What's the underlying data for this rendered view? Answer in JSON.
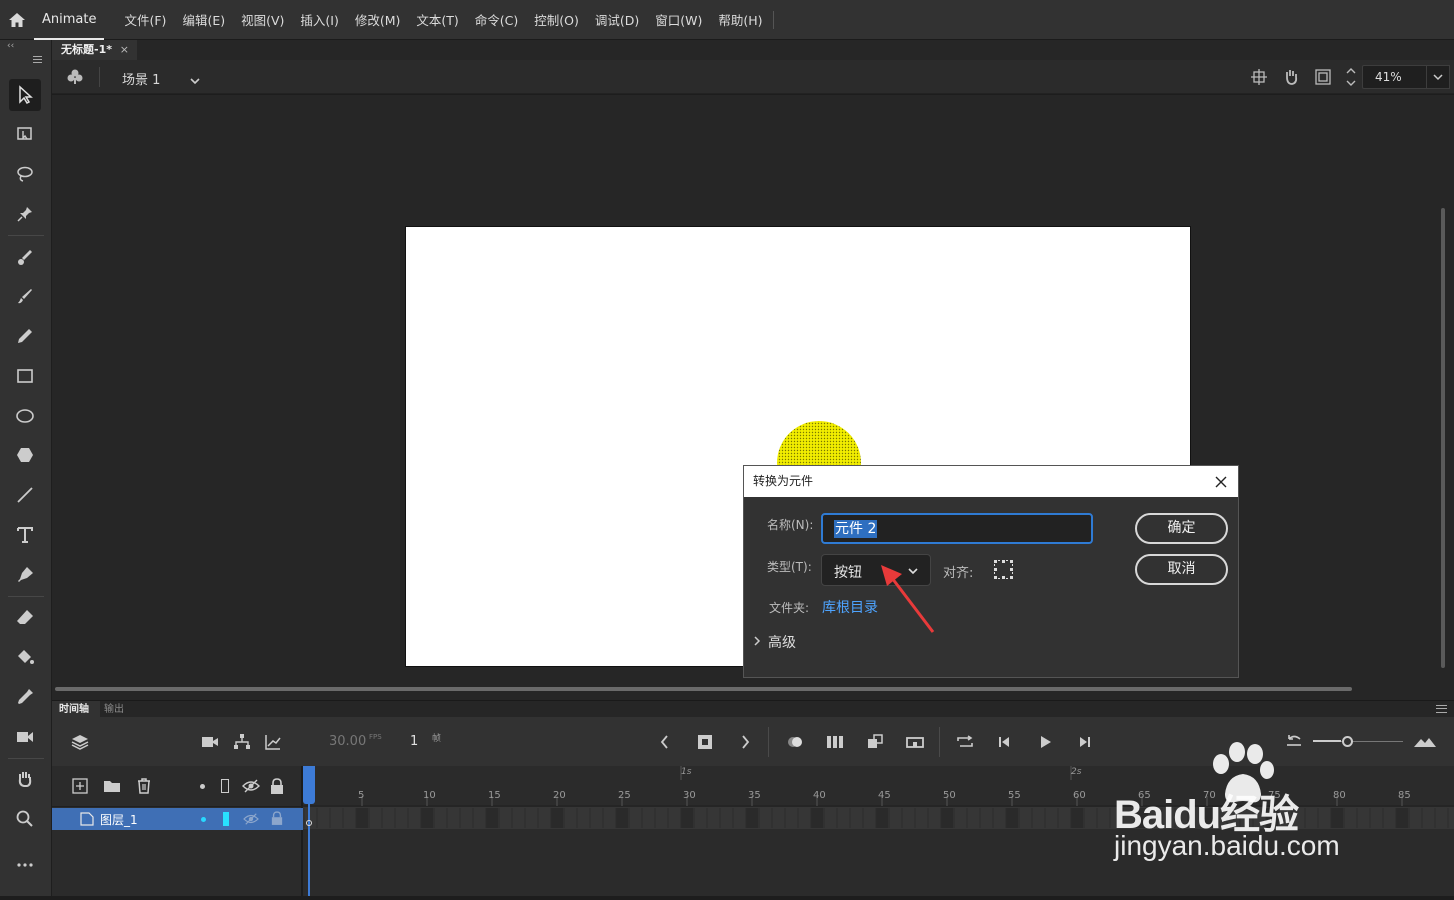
{
  "app": {
    "name": "Animate"
  },
  "menu": [
    "文件(F)",
    "编辑(E)",
    "视图(V)",
    "插入(I)",
    "修改(M)",
    "文本(T)",
    "命令(C)",
    "控制(O)",
    "调试(D)",
    "窗口(W)",
    "帮助(H)"
  ],
  "document": {
    "tab_title": "无标题-1*",
    "close_glyph": "×"
  },
  "scene": {
    "label": "场景 1",
    "zoom": "41%"
  },
  "dialog": {
    "title": "转换为元件",
    "name_label": "名称(N):",
    "name_value": "元件 2",
    "type_label": "类型(T):",
    "type_value": "按钮",
    "align_label": "对齐:",
    "folder_label": "文件夹:",
    "folder_value": "库根目录",
    "advanced_label": "高级",
    "ok_label": "确定",
    "cancel_label": "取消"
  },
  "timeline": {
    "tab_timeline": "时间轴",
    "tab_output": "输出",
    "fps": "30.00",
    "fps_unit": "FPS",
    "frame": "1",
    "frame_unit": "帧",
    "layer_name": "图层_1",
    "seconds_markers": [
      "1s",
      "2s"
    ],
    "frame_numbers": [
      "5",
      "10",
      "15",
      "20",
      "25",
      "30",
      "35",
      "40",
      "45",
      "50",
      "55",
      "60",
      "65",
      "70",
      "75",
      "80",
      "85"
    ]
  },
  "watermark": {
    "text": "Baidu经验",
    "url_text": "jingyan.baidu.com"
  },
  "colors": {
    "accent": "#2f7bd4",
    "link": "#4ea4ff",
    "circle": "#e6e600",
    "arrow": "#e83a3a",
    "playhead": "#3d7bd6"
  }
}
